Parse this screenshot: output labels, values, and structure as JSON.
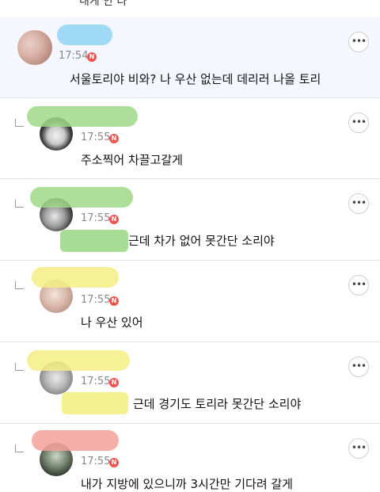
{
  "top_stub": {
    "text": "내게 안 나"
  },
  "comments": [
    {
      "name_color": "#8fd3f4",
      "time": "17:54",
      "badge": "N",
      "text": "서울토리야 비와? 나 우산 없는데 데리러 나올 토리",
      "mention_color": "",
      "avatar": "avatar-icon"
    },
    {
      "name_color": "#9fd98a",
      "time": "17:55",
      "badge": "N",
      "text": "주소찍어 차끌고갈게",
      "mention_color": "",
      "avatar": "avatar-icon"
    },
    {
      "name_color": "#9fd98a",
      "time": "17:55",
      "badge": "N",
      "text": "근데 차가 없어 못간단 소리야",
      "mention_color": "#9fd98a",
      "avatar": "avatar-icon"
    },
    {
      "name_color": "#f4ef85",
      "time": "17:55",
      "badge": "N",
      "text": "나 우산 있어",
      "mention_color": "",
      "avatar": "avatar-icon"
    },
    {
      "name_color": "#f4ef85",
      "time": "17:55",
      "badge": "N",
      "text": "근데 경기도 토리라 못간단 소리야",
      "mention_color": "#f4ef85",
      "avatar": "avatar-icon"
    },
    {
      "name_color": "#f4a09a",
      "time": "17:55",
      "badge": "N",
      "text": "내가 지방에 있으니까 3시간만 기다려 갈게",
      "mention_color": "",
      "avatar": "avatar-icon"
    }
  ],
  "more_label": "•••"
}
